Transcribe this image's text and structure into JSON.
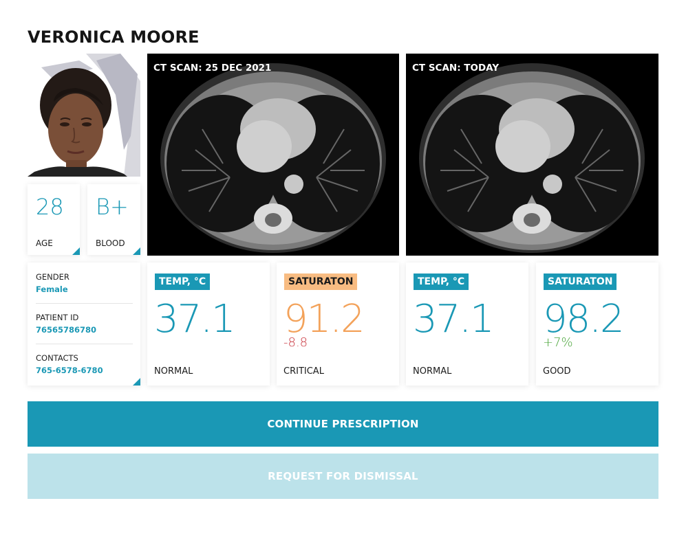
{
  "patient": {
    "name": "VERONICA MOORE",
    "age": "28",
    "age_label": "AGE",
    "blood": "B+",
    "blood_label": "BLOOD",
    "gender_label": "GENDER",
    "gender": "Female",
    "id_label": "PATIENT ID",
    "id": "76565786780",
    "contacts_label": "CONTACTS",
    "contacts": "765-6578-6780"
  },
  "scans": [
    {
      "label": "CT SCAN: 25 DEC 2021"
    },
    {
      "label": "CT SCAN: TODAY"
    }
  ],
  "metrics": [
    {
      "tag": "TEMP, °C",
      "value": "37.1",
      "delta": "",
      "status": "NORMAL",
      "color": "#1a98b5"
    },
    {
      "tag": "SATURATON",
      "value": "91.2",
      "delta": "-8.8",
      "status": "CRITICAL",
      "color": "#f3a25a",
      "delta_color": "#c8323b"
    },
    {
      "tag": "TEMP, °C",
      "value": "37.1",
      "delta": "",
      "status": "NORMAL",
      "color": "#1a98b5"
    },
    {
      "tag": "SATURATON",
      "value": "98.2",
      "delta": "+7%",
      "status": "GOOD",
      "color": "#1a98b5",
      "delta_color": "#4aa53a"
    }
  ],
  "actions": {
    "continue": "CONTINUE PRESCRIPTION",
    "dismiss": "REQUEST FOR DISMISSAL"
  },
  "colors": {
    "accent": "#1a98b5",
    "accent_light": "#bce2ea",
    "warning": "#f3a25a",
    "danger": "#c8323b",
    "good": "#4aa53a"
  }
}
